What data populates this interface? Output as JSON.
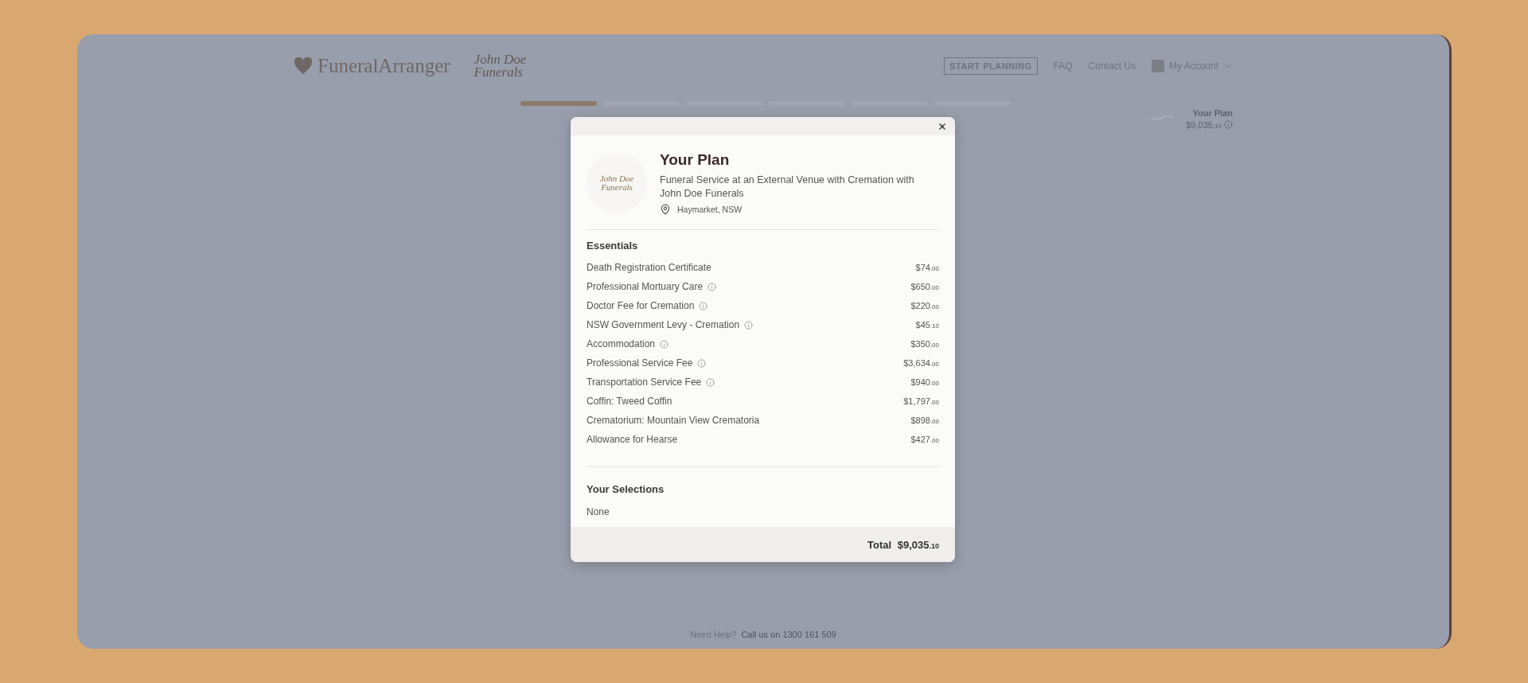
{
  "header": {
    "brand": "FuneralArranger",
    "partner_logo": "John Doe Funerals",
    "nav": [
      {
        "kind": "button",
        "label": "START PLANNING"
      },
      {
        "kind": "link",
        "label": "FAQ"
      },
      {
        "kind": "link",
        "label": "Contact Us"
      },
      {
        "kind": "account",
        "label": "My Account"
      }
    ]
  },
  "progress": {
    "steps": [
      {
        "done": true
      },
      {
        "done": false
      },
      {
        "done": false
      },
      {
        "done": false
      },
      {
        "done": false
      },
      {
        "done": false
      }
    ]
  },
  "plan_summary": {
    "title": "Your Plan",
    "amount": "$9,035",
    "cents": ".10"
  },
  "modal": {
    "title": "Your Plan",
    "description": "Funeral Service at an External Venue with Cremation with John Doe Funerals",
    "logo": "John Doe Funerals",
    "location": "Haymarket, NSW",
    "essentials_heading": "Essentials",
    "essentials": [
      {
        "name": "Death Registration Certificate",
        "info": false,
        "amount": "$74",
        "cents": ".00"
      },
      {
        "name": "Professional Mortuary Care",
        "info": true,
        "amount": "$650",
        "cents": ".00"
      },
      {
        "name": "Doctor Fee for Cremation",
        "info": true,
        "amount": "$220",
        "cents": ".00"
      },
      {
        "name": "NSW Government Levy - Cremation",
        "info": true,
        "amount": "$45",
        "cents": ".10"
      },
      {
        "name": "Accommodation",
        "info": true,
        "amount": "$350",
        "cents": ".00"
      },
      {
        "name": "Professional Service Fee",
        "info": true,
        "amount": "$3,634",
        "cents": ".00"
      },
      {
        "name": "Transportation Service Fee",
        "info": true,
        "amount": "$940",
        "cents": ".00"
      },
      {
        "name": "Coffin: Tweed Coffin",
        "info": false,
        "amount": "$1,797",
        "cents": ".00"
      },
      {
        "name": "Crematorium: Mountain View Crematoria",
        "info": false,
        "amount": "$898",
        "cents": ".00"
      },
      {
        "name": "Allowance for Hearse",
        "info": false,
        "amount": "$427",
        "cents": ".00"
      }
    ],
    "selections_heading": "Your Selections",
    "selections": "None",
    "total_label": "Total",
    "total_amount": "$9,035",
    "total_cents": ".10"
  },
  "footer": {
    "question": "Need Help?",
    "text": "Call us on 1300 161 509"
  }
}
